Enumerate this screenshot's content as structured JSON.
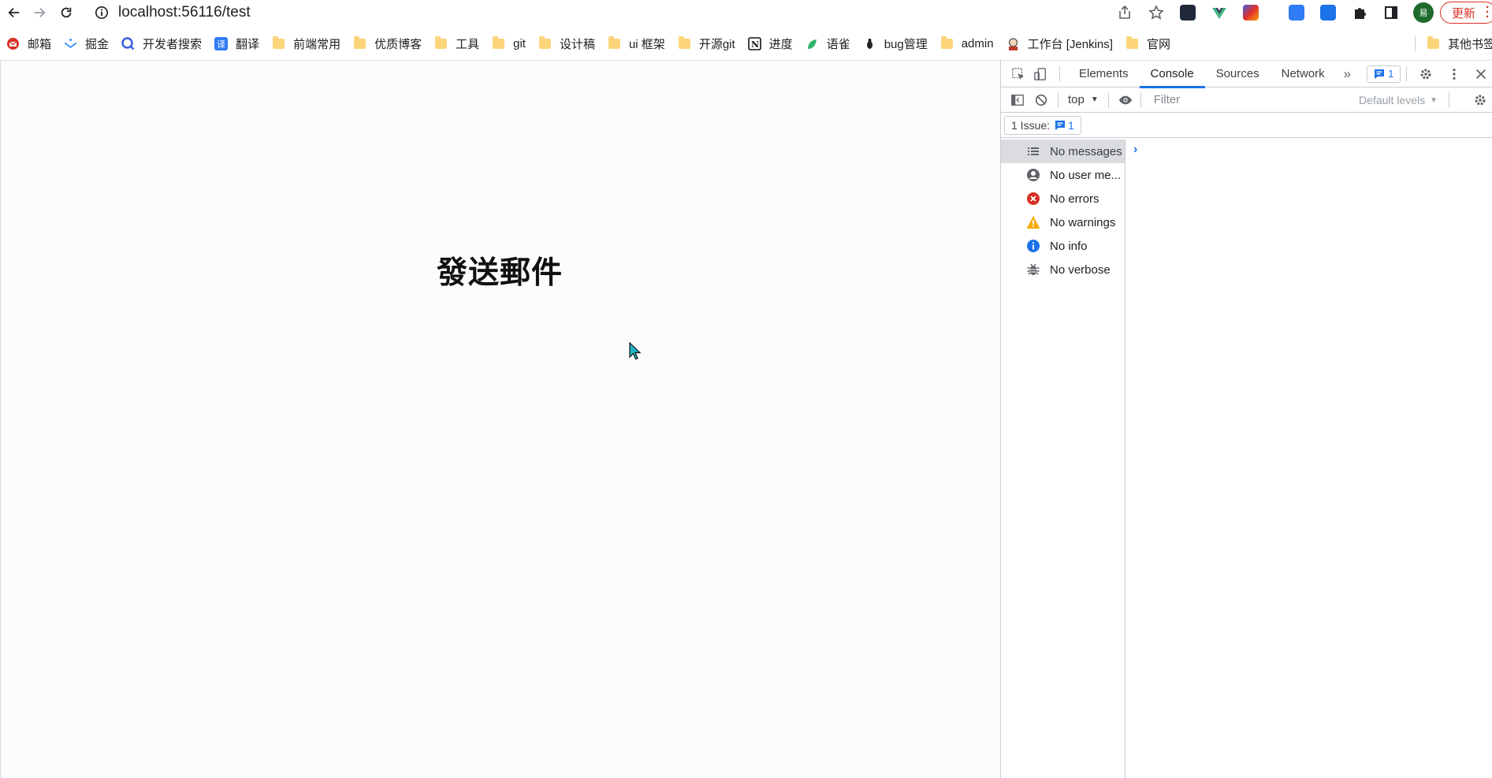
{
  "browser": {
    "url": "localhost:56116/test",
    "profile_initial": "易",
    "update_label": "更新"
  },
  "bookmarks": [
    {
      "label": "邮箱",
      "icon": "mail-icon",
      "color": "#d93025"
    },
    {
      "label": "掘金",
      "icon": "juejin-icon",
      "color": "#1e80ff"
    },
    {
      "label": "开发者搜索",
      "icon": "search-icon",
      "color": "#3b5fe0"
    },
    {
      "label": "翻译",
      "icon": "translate-icon",
      "color": "#2f7cf6"
    },
    {
      "label": "前端常用",
      "icon": "folder-icon"
    },
    {
      "label": "优质博客",
      "icon": "folder-icon"
    },
    {
      "label": "工具",
      "icon": "folder-icon"
    },
    {
      "label": "git",
      "icon": "folder-icon"
    },
    {
      "label": "设计稿",
      "icon": "folder-icon"
    },
    {
      "label": "ui 框架",
      "icon": "folder-icon"
    },
    {
      "label": "开源git",
      "icon": "folder-icon"
    },
    {
      "label": "进度",
      "icon": "notion-icon"
    },
    {
      "label": "语雀",
      "icon": "yuque-icon",
      "color": "#2fb36b"
    },
    {
      "label": "bug管理",
      "icon": "bug-icon"
    },
    {
      "label": "admin",
      "icon": "folder-icon"
    },
    {
      "label": "工作台 [Jenkins]",
      "icon": "jenkins-icon"
    },
    {
      "label": "官网",
      "icon": "folder-icon"
    }
  ],
  "other_bookmarks_label": "其他书签",
  "page": {
    "title": "發送郵件"
  },
  "devtools": {
    "tabs": [
      "Elements",
      "Console",
      "Sources",
      "Network"
    ],
    "active_tab": "Console",
    "issues_badge_count": "1",
    "context": "top",
    "filter_placeholder": "Filter",
    "levels_label": "Default levels",
    "issues_row_label": "1 Issue:",
    "issues_row_count": "1",
    "sidebar": [
      {
        "label": "No messages",
        "icon": "list-icon",
        "selected": true
      },
      {
        "label": "No user me...",
        "icon": "user-icon"
      },
      {
        "label": "No errors",
        "icon": "error-icon",
        "color": "#d93025"
      },
      {
        "label": "No warnings",
        "icon": "warning-icon",
        "color": "#f9ab00"
      },
      {
        "label": "No info",
        "icon": "info-icon",
        "color": "#1a73e8"
      },
      {
        "label": "No verbose",
        "icon": "bug-verbose-icon"
      }
    ],
    "accent_color": "#1a73e8"
  }
}
